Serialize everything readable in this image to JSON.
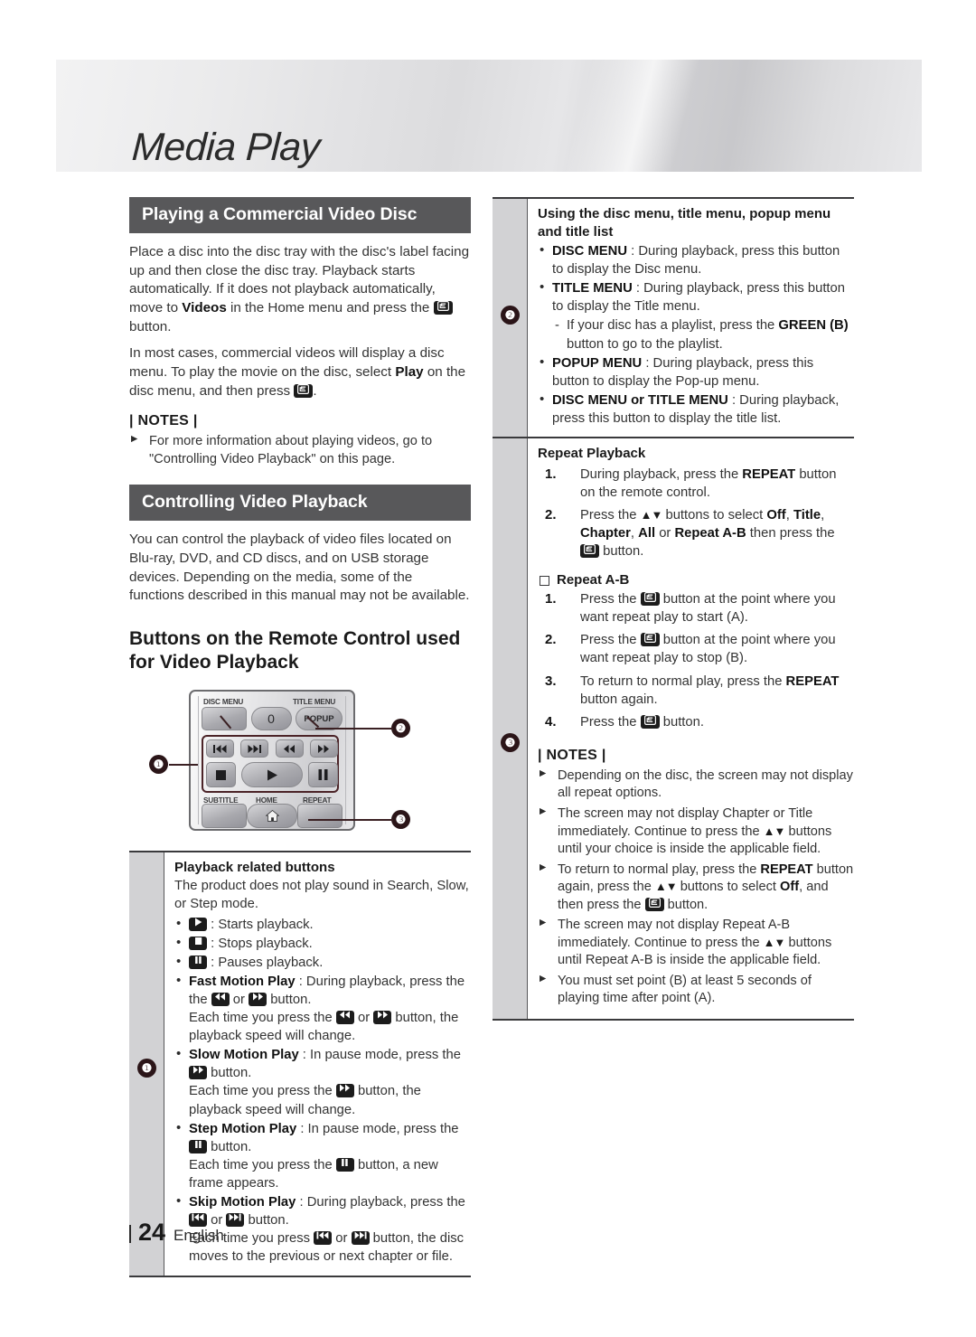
{
  "header": {
    "title": "Media Play"
  },
  "footer": {
    "page_number": "24",
    "language": "English"
  },
  "left": {
    "section1": {
      "bar_title": "Playing a Commercial Video Disc",
      "para1_a": "Place a disc into the disc tray with the disc's label facing up and then close the disc tray. Playback starts automatically. If it does not playback automatically, move to ",
      "para1_bold1": "Videos",
      "para1_b": " in the Home menu and press the ",
      "para1_c": " button.",
      "para2_a": "In most cases, commercial videos will display a disc menu. To play the movie on the disc, select ",
      "para2_bold1": "Play",
      "para2_b": " on the disc menu, and then press ",
      "para2_c": ".",
      "notes_title": "| NOTES |",
      "notes": [
        "For more information about playing videos, go to \"Controlling Video Playback\" on this page."
      ]
    },
    "section2": {
      "bar_title": "Controlling Video Playback",
      "para1": "You can control the playback of video files located on Blu-ray, DVD, and CD discs, and on USB storage devices. Depending on the media, some of the functions described in this manual may not be available.",
      "subhead": "Buttons on the Remote Control used for Video Playback"
    },
    "remote": {
      "label_disc_menu": "DISC MENU",
      "label_title_menu": "TITLE MENU",
      "key_zero": "0",
      "key_popup": "POPUP",
      "label_subtitle": "SUBTITLE",
      "label_home": "HOME",
      "label_repeat": "REPEAT",
      "callout_1": "❶",
      "callout_2": "❷",
      "callout_3": "❸"
    },
    "block1": {
      "badge": "❶",
      "title": "Playback related buttons",
      "intro": "The product does not play sound in Search, Slow, or Step mode.",
      "items": [
        {
          "icon": "play",
          "text": " : Starts playback."
        },
        {
          "icon": "stop",
          "text": " : Stops playback."
        },
        {
          "icon": "pause",
          "text": " : Pauses playback."
        }
      ],
      "fast_label": "Fast Motion Play",
      "fast_a": " : During playback, press the ",
      "fast_b": " or ",
      "fast_c": " button.",
      "fast_d": "Each time you press the ",
      "fast_e": " or ",
      "fast_f": " button, the playback speed will change.",
      "slow_label": "Slow Motion Play",
      "slow_a": " : In pause mode, press the ",
      "slow_b": " button.",
      "slow_c": "Each time you press the ",
      "slow_d": " button, the playback speed will change.",
      "step_label": "Step Motion Play",
      "step_a": " : In pause mode, press the ",
      "step_b": " button.",
      "step_c": "Each time you press the ",
      "step_d": " button, a new frame appears.",
      "skip_label": "Skip Motion Play",
      "skip_a": " : During playback, press the ",
      "skip_b": " or ",
      "skip_c": " button.",
      "skip_d": "Each time you press ",
      "skip_e": " or ",
      "skip_f": " button, the disc moves to the previous or next chapter or file."
    }
  },
  "right": {
    "block2": {
      "badge": "❷",
      "title": "Using the disc menu, title menu, popup menu and title list",
      "item1_label": "DISC MENU",
      "item1_text": " : During playback, press this button to display the Disc menu.",
      "item2_label": "TITLE MENU",
      "item2_text": " : During playback, press this button to display the Title menu.",
      "sub_a": "If your disc has a playlist, press the ",
      "sub_bold1": "GREEN (B)",
      "sub_b": " button to go to the playlist.",
      "item3_label": "POPUP MENU",
      "item3_text": " : During playback, press this button to display the Pop-up menu.",
      "item4_label": "DISC MENU or TITLE MENU",
      "item4_text": " : During playback, press this button to display the title list."
    },
    "repeat": {
      "title": "Repeat Playback",
      "step1_a": "During playback, press the ",
      "step1_bold": "REPEAT",
      "step1_b": " button on the remote control.",
      "step2_a": "Press the ",
      "step2_arrows": "▲▼",
      "step2_b": " buttons to select ",
      "step2_opts1": "Off",
      "step2_c": ", ",
      "step2_opts2": "Title",
      "step2_d": ", ",
      "step2_opts3": "Chapter",
      "step2_e": ", ",
      "step2_opts4": "All",
      "step2_f": " or ",
      "step2_opts5": "Repeat A-B",
      "step2_g": " then press the ",
      "step2_h": " button."
    },
    "repeat_ab": {
      "badge": "❸",
      "title": "Repeat A-B",
      "step1_a": "Press the ",
      "step1_b": " button at the point where you want repeat play to start (A).",
      "step2_a": "Press the ",
      "step2_b": " button at the point where you want repeat play to stop (B).",
      "step3_a": "To return to normal play, press the ",
      "step3_bold": "REPEAT",
      "step3_b": " button again.",
      "step4_a": "Press the ",
      "step4_b": " button.",
      "notes_title": "| NOTES |",
      "note1": "Depending on the disc, the screen may not display all repeat options.",
      "note2_a": "The screen may not display Chapter or Title immediately. Continue to press the ",
      "note2_arrows": "▲▼",
      "note2_b": " buttons until your choice is inside the applicable field.",
      "note3_a": "To return to normal play, press the ",
      "note3_bold1": "REPEAT",
      "note3_b": " button again, press the ",
      "note3_arrows": "▲▼",
      "note3_c": " buttons to select ",
      "note3_bold2": "Off",
      "note3_d": ", and then press the ",
      "note3_e": " button.",
      "note4_a": "The screen may not display Repeat A-B immediately. Continue to press the ",
      "note4_arrows": "▲▼",
      "note4_b": " buttons until Repeat A-B is inside the applicable field.",
      "note5": "You must set point (B) at least 5 seconds of playing time after point (A)."
    }
  },
  "colors": {
    "bar_bg": "#58585a",
    "band_bg": "#d2d2d4",
    "callout_bg": "#2b1518",
    "rule": "#3a3a3c"
  }
}
